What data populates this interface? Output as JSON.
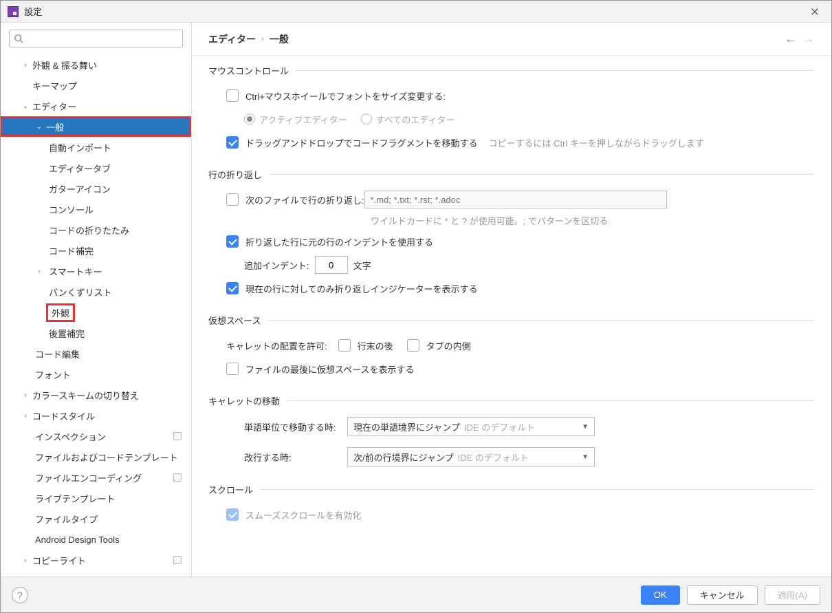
{
  "window": {
    "title": "設定"
  },
  "breadcrumb": {
    "part1": "エディター",
    "sep": "›",
    "part2": "一般"
  },
  "sidebar": {
    "items": [
      {
        "label": "外観 & 振る舞い"
      },
      {
        "label": "キーマップ"
      },
      {
        "label": "エディター"
      },
      {
        "label": "一般"
      },
      {
        "label": "自動インポート"
      },
      {
        "label": "エディタータブ"
      },
      {
        "label": "ガターアイコン"
      },
      {
        "label": "コンソール"
      },
      {
        "label": "コードの折りたたみ"
      },
      {
        "label": "コード補完"
      },
      {
        "label": "スマートキー"
      },
      {
        "label": "パンくずリスト"
      },
      {
        "label": "外観"
      },
      {
        "label": "後置補完"
      },
      {
        "label": "コード編集"
      },
      {
        "label": "フォント"
      },
      {
        "label": "カラースキームの切り替え"
      },
      {
        "label": "コードスタイル"
      },
      {
        "label": "インスペクション"
      },
      {
        "label": "ファイルおよびコードテンプレート"
      },
      {
        "label": "ファイルエンコーディング"
      },
      {
        "label": "ライブテンプレート"
      },
      {
        "label": "ファイルタイプ"
      },
      {
        "label": "Android Design Tools"
      },
      {
        "label": "コピーライト"
      }
    ]
  },
  "sections": {
    "mouse": {
      "title": "マウスコントロール",
      "ctrl_wheel": "Ctrl+マウスホイールでフォントをサイズ変更する:",
      "active_editor": "アクティブエディター",
      "all_editors": "すべてのエディター",
      "dnd": "ドラッグアンドドロップでコードフラグメントを移動する",
      "dnd_hint": "コピーするには Ctrl キーを押しながらドラッグします"
    },
    "wrap": {
      "title": "行の折り返し",
      "soft_wrap_files": "次のファイルで行の折り返し:",
      "soft_wrap_placeholder": "*.md; *.txt; *.rst; *.adoc",
      "wildcard_hint": "ワイルドカードに * と ? が使用可能。; でパターンを区切る",
      "use_indent": "折り返した行に元の行のインデントを使用する",
      "extra_indent_label": "追加インデント:",
      "extra_indent_value": "0",
      "extra_indent_unit": "文字",
      "indicator": "現在の行に対してのみ折り返しインジケーターを表示する"
    },
    "virtual": {
      "title": "仮想スペース",
      "caret_allow": "キャレットの配置を許可:",
      "after_eol": "行末の後",
      "inside_tab": "タブの内側",
      "show_eof": "ファイルの最後に仮想スペースを表示する"
    },
    "caret": {
      "title": "キャレットの移動",
      "word_label": "単語単位で移動する時:",
      "word_value": "現在の単語境界にジャンプ",
      "word_hint": "IDE のデフォルト",
      "newline_label": "改行する時:",
      "newline_value": "次/前の行境界にジャンプ",
      "newline_hint": "IDE のデフォルト"
    },
    "scroll": {
      "title": "スクロール",
      "smooth": "スムーズスクロールを有効化"
    }
  },
  "footer": {
    "ok": "OK",
    "cancel": "キャンセル",
    "apply": "適用(A)"
  }
}
